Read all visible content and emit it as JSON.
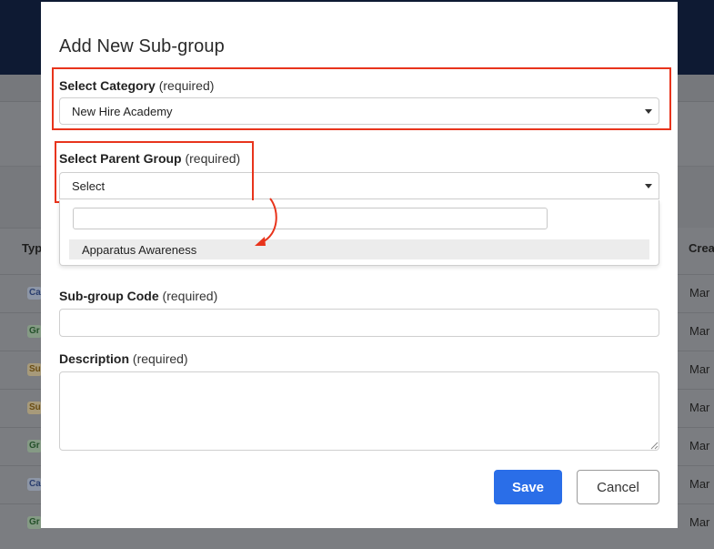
{
  "modal": {
    "title": "Add New Sub-group",
    "category": {
      "label": "Select Category",
      "required": "(required)",
      "value": "New Hire Academy"
    },
    "parent_group": {
      "label": "Select Parent Group",
      "required": "(required)",
      "value": "Select",
      "search_placeholder": "",
      "options": [
        "Apparatus Awareness"
      ]
    },
    "subgroup_code": {
      "label": "Sub-group Code",
      "required": "(required)",
      "value": ""
    },
    "description": {
      "label": "Description",
      "required": "(required)",
      "value": ""
    },
    "save_label": "Save",
    "cancel_label": "Cancel"
  },
  "background": {
    "col_type": "Typ",
    "col_created": "Crea",
    "chips": [
      "Ca",
      "Gr",
      "Su",
      "Su",
      "Gr",
      "Ca",
      "Gr"
    ],
    "dates": [
      "Mar",
      "Mar",
      "Mar",
      "Mar",
      "Mar",
      "Mar",
      "Mar"
    ]
  },
  "annotation": {
    "color": "#e8341c"
  },
  "colors": {
    "primary": "#2a6ee8",
    "header": "#0e1a33"
  }
}
